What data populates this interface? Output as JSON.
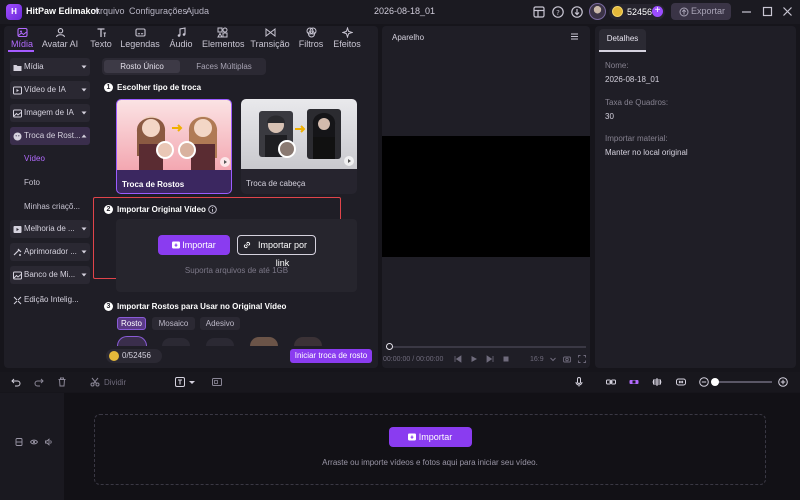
{
  "titlebar": {
    "app_name": "HitPaw Edimakor",
    "menu": [
      "Arquivo",
      "Configurações",
      "Ajuda"
    ],
    "project_name": "2026-08-18_01",
    "coins": "52456",
    "export_label": "Exportar"
  },
  "categories": [
    {
      "label": "Mídia",
      "icon": "media-icon",
      "active": true
    },
    {
      "label": "Avatar AI",
      "icon": "avatar-icon"
    },
    {
      "label": "Texto",
      "icon": "text-icon"
    },
    {
      "label": "Legendas",
      "icon": "subtitles-icon"
    },
    {
      "label": "Áudio",
      "icon": "audio-icon"
    },
    {
      "label": "Elementos",
      "icon": "elements-icon"
    },
    {
      "label": "Transição",
      "icon": "transition-icon"
    },
    {
      "label": "Filtros",
      "icon": "filters-icon"
    },
    {
      "label": "Efeitos",
      "icon": "effects-icon"
    }
  ],
  "sidebar": {
    "items": [
      {
        "label": "Mídia",
        "icon": "folder-icon"
      },
      {
        "label": "Vídeo de IA",
        "icon": "video-ai-icon"
      },
      {
        "label": "Imagem de IA",
        "icon": "image-ai-icon"
      },
      {
        "label": "Troca de Rost...",
        "icon": "face-swap-icon",
        "active": true
      },
      {
        "label": "Melhoria de ...",
        "icon": "enhance-icon"
      },
      {
        "label": "Aprimorador ...",
        "icon": "enhancer-icon"
      },
      {
        "label": "Banco de Mi...",
        "icon": "bank-icon"
      },
      {
        "label": "Edição Intelig...",
        "icon": "smart-edit-icon"
      }
    ],
    "subitems": [
      "Vídeo",
      "Foto",
      "Minhas criaçõ..."
    ]
  },
  "faceswap": {
    "seg_active": "Rosto Único",
    "seg_other": "Faces Múltiplas",
    "step1_num": "1",
    "step1_title": "Escolher tipo de troca",
    "card1_label": "Troca de Rostos",
    "card2_label": "Troca de cabeça",
    "step2_num": "2",
    "step2_title": "Importar Original Vídeo",
    "import_label": "Importar",
    "import_link_label": "Importar por link",
    "support_text": "Suporta arquivos de até 1GB",
    "step3_num": "3",
    "step3_title": "Importar Rostos para Usar no Original Vídeo",
    "face_tabs": [
      "Rosto",
      "Mosaico",
      "Adesivo"
    ],
    "coins_text": "0/52456",
    "start_label": "Iniciar troca de rosto"
  },
  "preview": {
    "title": "Aparelho",
    "time": "00:00:00 / 00:00:00",
    "ratio": "16:9"
  },
  "details": {
    "tab": "Detalhes",
    "name_label": "Nome:",
    "name_value": "2026-08-18_01",
    "fps_label": "Taxa de Quadros:",
    "fps_value": "30",
    "import_label": "Importar material:",
    "import_value": "Manter no local original"
  },
  "timeline": {
    "divide_label": "Dividir",
    "import_label": "Importar",
    "drop_hint": "Arraste ou importe vídeos e fotos aqui para iniciar seu vídeo."
  },
  "colors": {
    "accent": "#8a3cf0",
    "highlight": "#e0444a",
    "background": "#16151b"
  }
}
